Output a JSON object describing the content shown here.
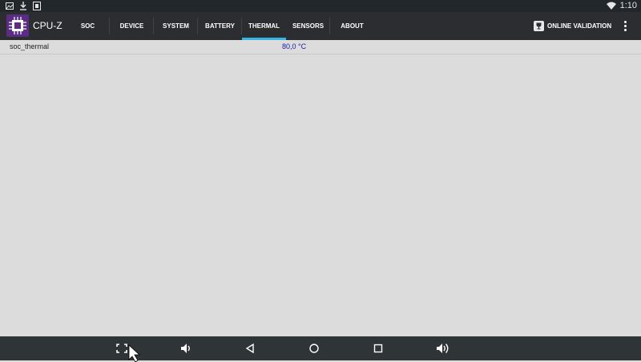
{
  "status_bar": {
    "time": "1:10",
    "icons": [
      "image-icon",
      "download-icon",
      "screenshot-icon",
      "wifi-icon"
    ]
  },
  "app_bar": {
    "title": "CPU-Z",
    "tabs": [
      {
        "label": "SOC"
      },
      {
        "label": "DEVICE"
      },
      {
        "label": "SYSTEM"
      },
      {
        "label": "BATTERY"
      },
      {
        "label": "THERMAL",
        "active": true
      },
      {
        "label": "SENSORS"
      },
      {
        "label": "ABOUT"
      }
    ],
    "validation_label": "ONLINE VALIDATION",
    "accent_color": "#34b5e5"
  },
  "thermal": {
    "rows": [
      {
        "label": "soc_thermal",
        "value": "80,0 °C"
      }
    ]
  },
  "nav_bar": {
    "buttons": [
      "fullscreen-icon",
      "volume-down-icon",
      "back-icon",
      "home-icon",
      "recents-icon",
      "volume-up-icon"
    ]
  }
}
